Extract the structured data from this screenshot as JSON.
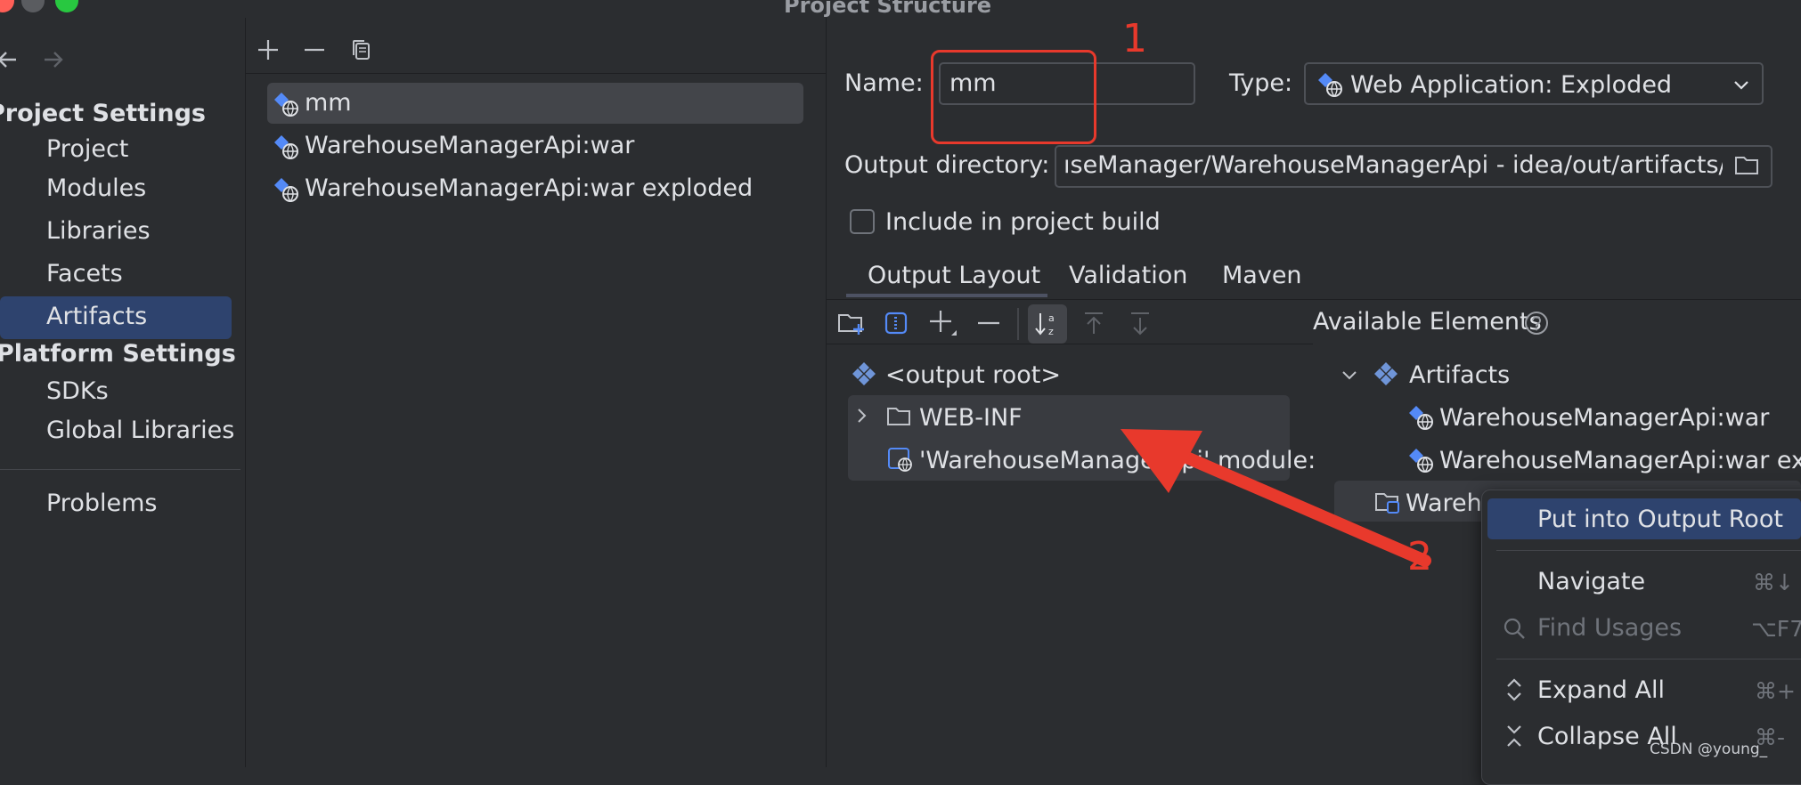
{
  "window": {
    "title": "Project Structure"
  },
  "sidebar": {
    "project_settings_header": "Project Settings",
    "project_items": [
      "Project",
      "Modules",
      "Libraries",
      "Facets",
      "Artifacts"
    ],
    "platform_settings_header": "Platform Settings",
    "platform_items": [
      "SDKs",
      "Global Libraries"
    ],
    "problems": "Problems"
  },
  "artifact_list": {
    "items": [
      "mm",
      "WarehouseManagerApi:war",
      "WarehouseManagerApi:war exploded"
    ]
  },
  "detail": {
    "name_label": "Name:",
    "name_value": "mm",
    "type_label": "Type:",
    "type_value": "Web Application: Exploded",
    "output_dir_label": "Output directory:",
    "output_dir_value": "ıseManager/WarehouseManagerApi - idea/out/artifacts/mm",
    "include_label": "Include in project build",
    "tabs": [
      "Output Layout",
      "Validation",
      "Maven"
    ],
    "available_elements": "Available Elements"
  },
  "output_tree": {
    "root": "<output root>",
    "web_inf": "WEB-INF",
    "module_output": "'WarehouseManagerApi' module: 'W"
  },
  "available_tree": {
    "artifacts": "Artifacts",
    "items": [
      "WarehouseManagerApi:war",
      "WarehouseManagerApi:war explo",
      "Wareh"
    ]
  },
  "context_menu": {
    "put_into_root": "Put into Output Root",
    "navigate": "Navigate",
    "navigate_shortcut": "⌘↓",
    "find_usages": "Find Usages",
    "find_usages_shortcut": "⌥F7",
    "expand_all": "Expand All",
    "expand_all_shortcut": "⌘+",
    "collapse_all": "Collapse All",
    "collapse_all_shortcut": "⌘-"
  },
  "annotations": {
    "label1": "1",
    "label2": "2"
  },
  "watermark": "CSDN @young_",
  "colors": {
    "accent": "#2e436e",
    "annotation_red": "#e8392c",
    "icon_blue": "#548af7"
  }
}
